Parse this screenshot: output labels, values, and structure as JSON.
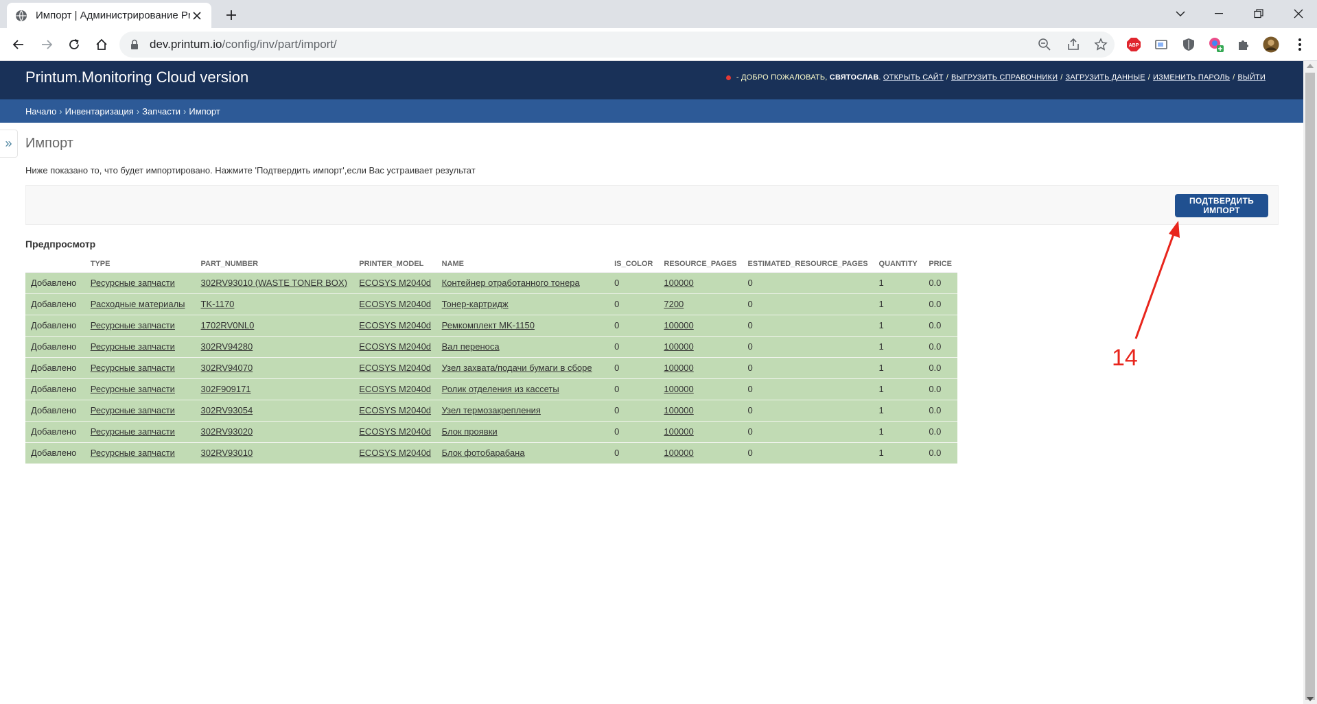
{
  "browser": {
    "tab_title": "Импорт | Администрирование Printum",
    "url_host": "dev.printum.io",
    "url_path": "/config/inv/part/import/"
  },
  "header": {
    "brand_prefix": "Printum.Monitoring",
    "brand_suffix": " Cloud version",
    "welcome": "- ДОБРО ПОЖАЛОВАТЬ,",
    "username": "СВЯТОСЛАВ",
    "links": [
      "ОТКРЫТЬ САЙТ",
      "ВЫГРУЗИТЬ СПРАВОЧНИКИ",
      "ЗАГРУЗИТЬ ДАННЫЕ",
      "ИЗМЕНИТЬ ПАРОЛЬ",
      "ВЫЙТИ"
    ]
  },
  "breadcrumbs": [
    "Начало",
    "Инвентаризация",
    "Запчасти",
    "Импорт"
  ],
  "sidebar_toggle": "»",
  "page": {
    "title": "Импорт",
    "description": "Ниже показано то, что будет импортировано. Нажмите 'Подтвердить импорт',если Вас устраивает результат",
    "confirm_button": "ПОДТВЕРДИТЬ ИМПОРТ",
    "preview_title": "Предпросмотр"
  },
  "table": {
    "columns": [
      "",
      "TYPE",
      "PART_NUMBER",
      "PRINTER_MODEL",
      "NAME",
      "IS_COLOR",
      "RESOURCE_PAGES",
      "ESTIMATED_RESOURCE_PAGES",
      "QUANTITY",
      "PRICE"
    ],
    "rows": [
      [
        "Добавлено",
        "Ресурсные запчасти",
        "302RV93010 (WASTE TONER BOX)",
        "ECOSYS M2040d",
        "Контейнер отработанного тонера",
        "0",
        "100000",
        "0",
        "1",
        "0.0"
      ],
      [
        "Добавлено",
        "Расходные материалы",
        "TK-1170",
        "ECOSYS M2040d",
        "Тонер-картридж",
        "0",
        "7200",
        "0",
        "1",
        "0.0"
      ],
      [
        "Добавлено",
        "Ресурсные запчасти",
        "1702RV0NL0",
        "ECOSYS M2040d",
        "Ремкомплект MK-1150",
        "0",
        "100000",
        "0",
        "1",
        "0.0"
      ],
      [
        "Добавлено",
        "Ресурсные запчасти",
        "302RV94280",
        "ECOSYS M2040d",
        "Вал переноса",
        "0",
        "100000",
        "0",
        "1",
        "0.0"
      ],
      [
        "Добавлено",
        "Ресурсные запчасти",
        "302RV94070",
        "ECOSYS M2040d",
        "Узел захвата/подачи бумаги в сборе",
        "0",
        "100000",
        "0",
        "1",
        "0.0"
      ],
      [
        "Добавлено",
        "Ресурсные запчасти",
        "302F909171",
        "ECOSYS M2040d",
        "Ролик отделения из кассеты",
        "0",
        "100000",
        "0",
        "1",
        "0.0"
      ],
      [
        "Добавлено",
        "Ресурсные запчасти",
        "302RV93054",
        "ECOSYS M2040d",
        "Узел термозакрепления",
        "0",
        "100000",
        "0",
        "1",
        "0.0"
      ],
      [
        "Добавлено",
        "Ресурсные запчасти",
        "302RV93020",
        "ECOSYS M2040d",
        "Блок проявки",
        "0",
        "100000",
        "0",
        "1",
        "0.0"
      ],
      [
        "Добавлено",
        "Ресурсные запчасти",
        "302RV93010",
        "ECOSYS M2040d",
        "Блок фотобарабана",
        "0",
        "100000",
        "0",
        "1",
        "0.0"
      ]
    ]
  },
  "annotation": {
    "label": "14",
    "color": "#e8251c"
  },
  "colors": {
    "header_bg": "#193158",
    "breadcrumb_bg": "#2d5a97",
    "row_added_bg": "#c1dbb4",
    "button_bg": "#205090"
  }
}
